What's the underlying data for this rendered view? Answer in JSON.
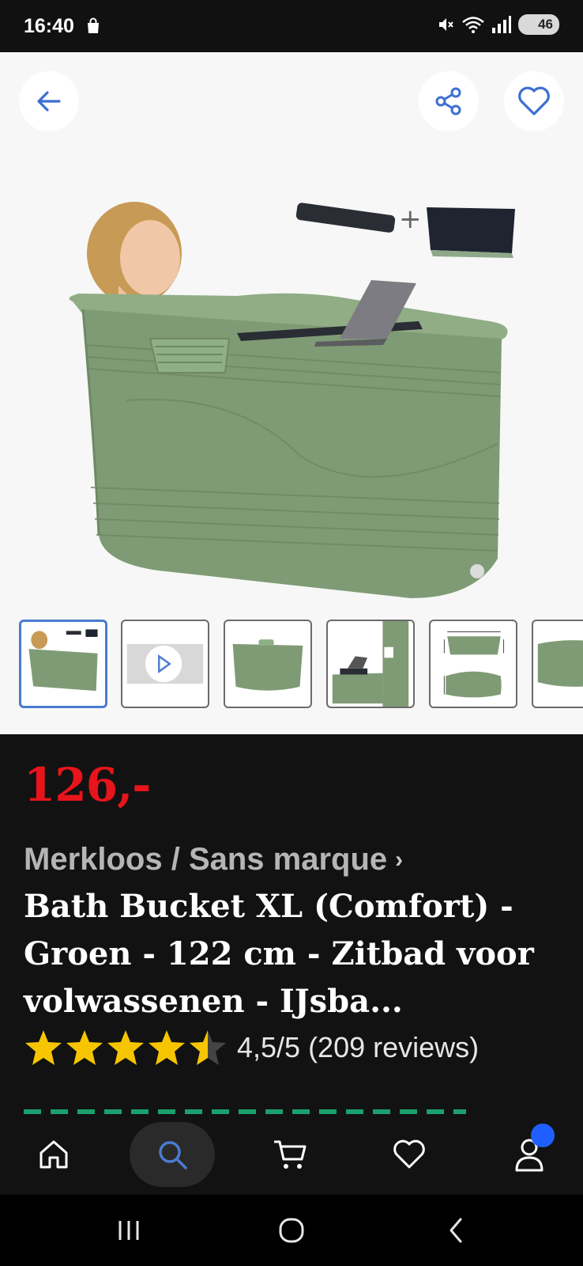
{
  "status_bar": {
    "time": "16:40",
    "battery": "46"
  },
  "hero": {
    "back_icon": "arrow-left-icon",
    "share_icon": "share-icon",
    "favorite_icon": "heart-icon"
  },
  "thumbnails": [
    {
      "name": "thumb-bath-person",
      "active": true
    },
    {
      "name": "thumb-video",
      "active": false
    },
    {
      "name": "thumb-bath-front",
      "active": false
    },
    {
      "name": "thumb-bath-laptop",
      "active": false
    },
    {
      "name": "thumb-dimensions",
      "active": false
    },
    {
      "name": "thumb-bath-side",
      "active": false
    }
  ],
  "product": {
    "price": "126,-",
    "brand": "Merkloos / Sans marque",
    "title": "Bath Bucket XL (Comfort) - Groen - 122 cm - Zitbad voor volwassenen - IJsba...",
    "rating": 4.5,
    "rating_text": "4,5/5 (209 reviews)"
  },
  "bottom_nav": [
    {
      "name": "home",
      "icon": "home-icon"
    },
    {
      "name": "search",
      "icon": "search-icon",
      "active": true
    },
    {
      "name": "cart",
      "icon": "cart-icon"
    },
    {
      "name": "favorites",
      "icon": "heart-icon"
    },
    {
      "name": "account",
      "icon": "user-icon"
    }
  ],
  "colors": {
    "price": "#e8141b",
    "accent": "#4a7bd0",
    "badge": "#1f5fff",
    "tub": "#7f9b75"
  }
}
